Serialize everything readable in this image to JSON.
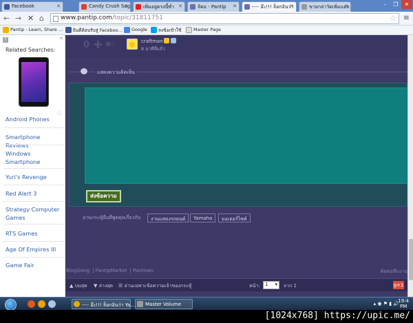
{
  "browser": {
    "tabs": [
      {
        "label": "Facebook",
        "favicon_color": "#3b5998"
      },
      {
        "label": "Candy Crush Sag",
        "favicon_color": "#e0402a"
      },
      {
        "label": "เพิ่มอยู่ตรงนี้ซ่ำ",
        "favicon_color": "#e62117"
      },
      {
        "label": "จ้ตอ - Pantip",
        "favicon_color": "#6f6fb0"
      },
      {
        "label": "---- อ๊ะ!!! ล็อกอินว่า",
        "favicon_color": "#6f6fb0"
      },
      {
        "label": "ขายกล่าวัดเพิ่มแอล",
        "favicon_color": "#999999"
      }
    ],
    "url_host": "www.pantip.com",
    "url_path": "/topic/31811751",
    "bookmarks": [
      {
        "label": "Pantip - Learn, Share ...",
        "icon_color": "#f0b400"
      },
      {
        "label": "ยินดีต้อนรับสู่ Faceboo...",
        "icon_color": "#3b5998"
      },
      {
        "label": "Google",
        "icon_color": "#4285f4"
      },
      {
        "label": "ลงข้อเข้าใช้",
        "icon_color": "#00a1f1"
      },
      {
        "label": "Master Page",
        "icon_color": "#cccccc"
      }
    ]
  },
  "sidebar": {
    "title": "Related Searches:",
    "items": [
      "Android Phones",
      "Smartphone Reviews",
      "Windows Smartphone",
      "Yuri's Revenge",
      "Red Alert 3",
      "Strategy Computer Games",
      "RTS Games",
      "Age Of Empires III",
      "Game Fair"
    ]
  },
  "post": {
    "vote_count": "0",
    "emotion_count": "0",
    "username": "craftman",
    "time_ago": "8 นาทีที่แล้ว"
  },
  "comment_section": {
    "label": "แสดงความคิดเห็น",
    "submit_label": "ส่งข้อความ"
  },
  "tags": {
    "prefix": "อ่านกระทู้อื่นที่พูดคุยเกี่ยวกับ",
    "items": [
      "งานแสดงรถยนต์",
      "Yamaha",
      "มอเตอร์ไซค์"
    ]
  },
  "footer": {
    "links": [
      "BlogGang",
      "PantipMarket",
      "Pantown"
    ],
    "right": "ติดต่อทีมงาน"
  },
  "bottom_bar": {
    "top_label": "บนสุด",
    "bottom_label": "ล่างสุด",
    "read_label": "อ่านเฉพาะข้อความเจ้าของกระทู้",
    "page_label": "หน้า:",
    "page_value": "1",
    "page_total": "จาก 1",
    "gplus_label": "g+1"
  },
  "taskbar": {
    "tasks": [
      "---- อ๊ะ!!! ล็อกอินว่า Ya...",
      "Master Volume"
    ],
    "clock_time": "19:4",
    "clock_ampm": "PM"
  },
  "watermark": "[1024x768] https://upic.me/"
}
